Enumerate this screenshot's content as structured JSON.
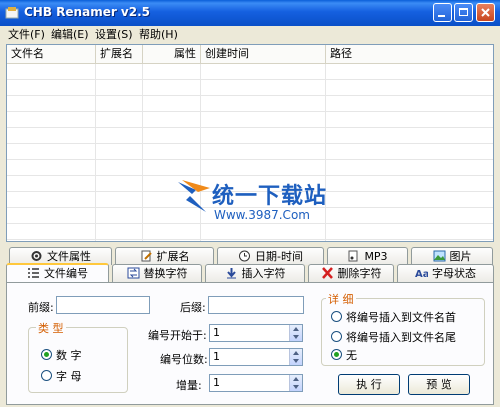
{
  "window": {
    "title": "CHB Renamer v2.5"
  },
  "menu": [
    "文件(F)",
    "编辑(E)",
    "设置(S)",
    "帮助(H)"
  ],
  "list": {
    "columns": [
      "文件名",
      "扩展名",
      "属性",
      "创建时间",
      "路径"
    ],
    "rows": []
  },
  "watermark": {
    "line1": "统一下载站",
    "line2": "Www.3987.Com"
  },
  "tabs_top": [
    "文件属性",
    "扩展名",
    "日期-时间",
    "MP3",
    "图片"
  ],
  "tabs_bottom": [
    "文件编号",
    "替换字符",
    "插入字符",
    "删除字符",
    "字母状态"
  ],
  "active_tab": "文件编号",
  "form": {
    "prefix_label": "前缀:",
    "prefix_value": "",
    "suffix_label": "后缀:",
    "suffix_value": "",
    "type_group": "类 型",
    "type_options": [
      "数 字",
      "字 母"
    ],
    "type_selected": "数 字",
    "start_label": "编号开始于:",
    "start_value": "1",
    "digits_label": "编号位数:",
    "digits_value": "1",
    "increment_label": "增量:",
    "increment_value": "1",
    "detail_group": "详 细",
    "detail_options": [
      "将编号插入到文件名首",
      "将编号插入到文件名尾",
      "无"
    ],
    "detail_selected": "无",
    "execute_label": "执 行",
    "preview_label": "预 览"
  },
  "colors": {
    "titlebar": "#0a5fd8",
    "accent": "#d45e00",
    "watermark": "#1e5fbf"
  }
}
